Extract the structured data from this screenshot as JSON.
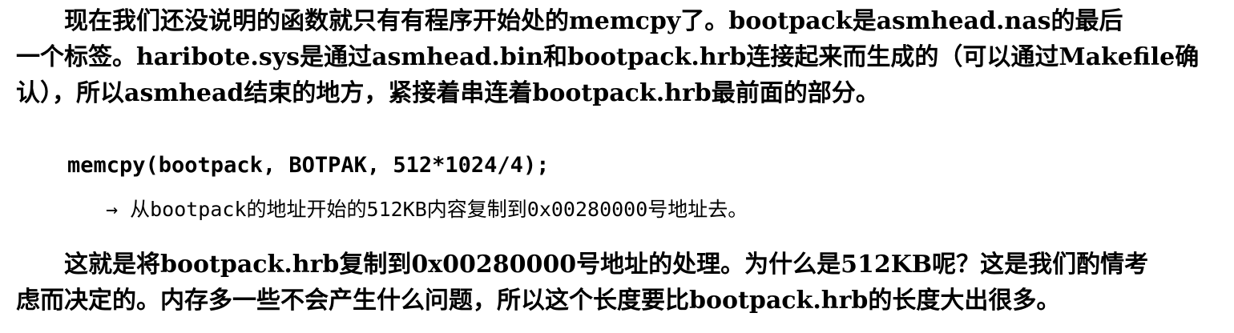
{
  "paragraph_1": {
    "lines": [
      "现在我们还没说明的函数就只有有程序开始处的memcpy了。bootpack是asmhead.nas的最后",
      "一个标签。haribote.sys是通过asmhead.bin和bootpack.hrb连接起来而生成的（可以通过Makefile确",
      "认），所以asmhead结束的地方，紧接着串连着bootpack.hrb最前面的部分。"
    ]
  },
  "code_example": {
    "statement": "memcpy(bootpack, BOTPAK, 512*1024/4);",
    "note": "→ 从bootpack的地址开始的512KB内容复制到0x00280000号地址去。"
  },
  "paragraph_2": {
    "lines": [
      "这就是将bootpack.hrb复制到0x00280000号地址的处理。为什么是512KB呢？这是我们酌情考",
      "虑而决定的。内存多一些不会产生什么问题，所以这个长度要比bootpack.hrb的长度大出很多。"
    ]
  }
}
